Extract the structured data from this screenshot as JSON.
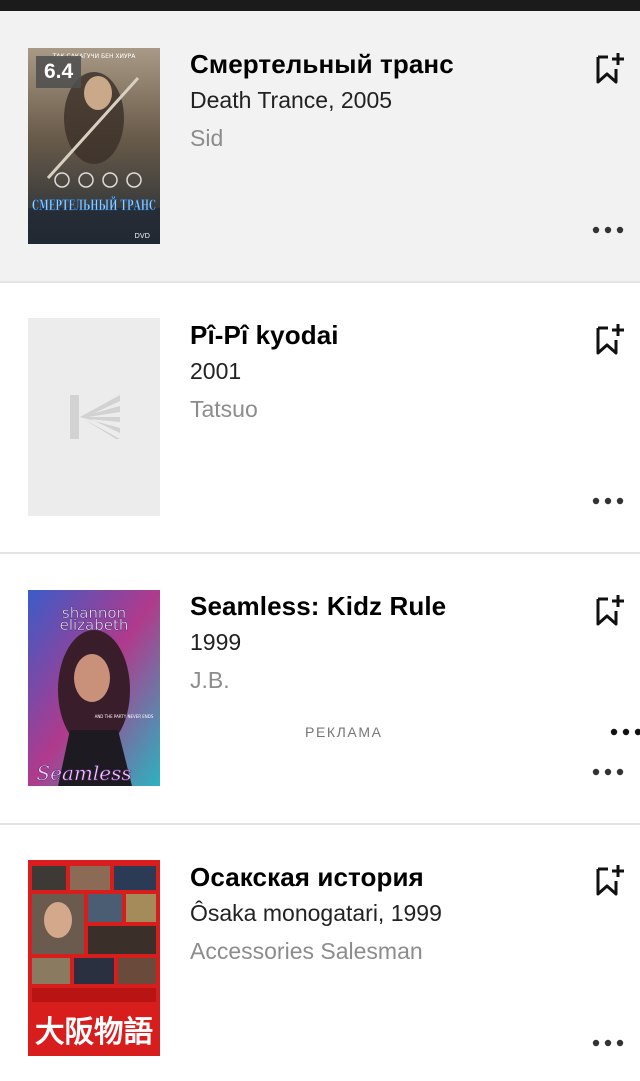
{
  "items": [
    {
      "title": "Смертельный транс",
      "subtitle": "Death Trance, 2005",
      "role": "Sid",
      "rating": "6.4",
      "poster": {
        "top_text": "ТАК САКАГУЧИ    БЕН ХИУРА",
        "title_text": "СМЕРТЕЛЬНЫЙ ТРАНС",
        "corner_text": "DVD"
      }
    },
    {
      "title": "Pî-Pî kyodai",
      "subtitle": "2001",
      "role": "Tatsuo"
    },
    {
      "title": "Seamless: Kidz Rule",
      "subtitle": "1999",
      "role": "J.B.",
      "ad_label": "РЕКЛАМА",
      "poster": {
        "name_line1": "shannon",
        "name_line2": "elizabeth",
        "tagline": "AND THE PARTY NEVER ENDS",
        "title_text": "Seamless"
      }
    },
    {
      "title": "Осакская история",
      "subtitle": "Ôsaka monogatari, 1999",
      "role": "Accessories Salesman",
      "poster": {
        "title_text": "大阪物語"
      }
    }
  ],
  "icons": {
    "bookmark": "bookmark-add-icon",
    "more": "more-dots-icon",
    "placeholder": "kinopoisk-logo-icon"
  },
  "colors": {
    "selected_row_bg": "#f2f2f2",
    "divider": "#e4e4e4",
    "role_text": "#8c8c8c",
    "rating_badge": "#505050"
  }
}
